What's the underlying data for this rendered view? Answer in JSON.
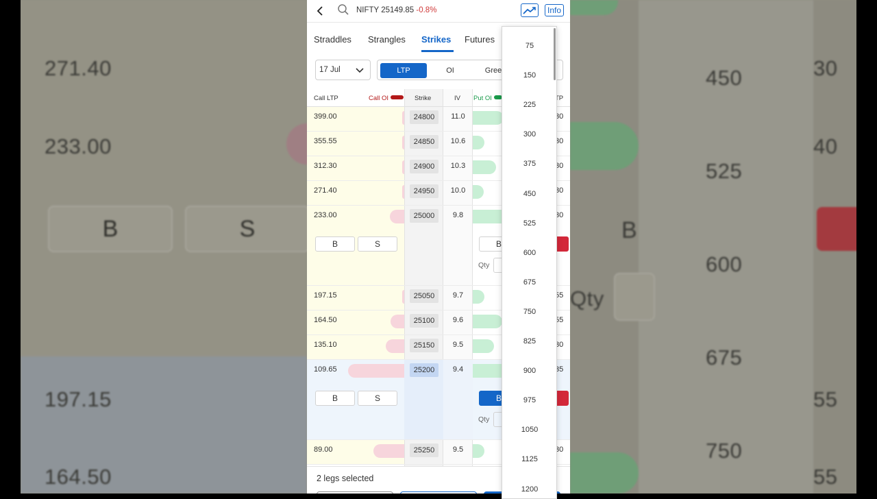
{
  "header": {
    "ticker_name": "NIFTY",
    "ticker_price": "25149.85",
    "ticker_change": "-0.8%",
    "info_label": "Info",
    "icons": [
      "chevron-left-icon",
      "search-icon",
      "trend-chart-icon"
    ]
  },
  "tabs": [
    {
      "label": "Straddles",
      "active": false
    },
    {
      "label": "Strangles",
      "active": false
    },
    {
      "label": "Strikes",
      "active": true
    },
    {
      "label": "Futures",
      "active": false
    }
  ],
  "controls": {
    "expiry_value": "17 Jul",
    "segments": [
      {
        "label": "LTP",
        "active": true
      },
      {
        "label": "OI",
        "active": false
      },
      {
        "label": "Gree",
        "active": false
      }
    ]
  },
  "table": {
    "headers": {
      "call_ltp": "Call LTP",
      "call_oi": "Call OI",
      "strike": "Strike",
      "iv": "IV",
      "put_oi": "Put OI",
      "put_ltp_fragment": "TP"
    },
    "rows": [
      {
        "call_ltp": "399.00",
        "strike": "24800",
        "iv": "11.0",
        "put_ltp_fragment": "30",
        "call_oi_pct": 2,
        "put_oi_pct": 32
      },
      {
        "call_ltp": "355.55",
        "strike": "24850",
        "iv": "10.6",
        "put_ltp_fragment": "30",
        "call_oi_pct": 1,
        "put_oi_pct": 12
      },
      {
        "call_ltp": "312.30",
        "strike": "24900",
        "iv": "10.3",
        "put_ltp_fragment": "30",
        "call_oi_pct": 2,
        "put_oi_pct": 24
      },
      {
        "call_ltp": "271.40",
        "strike": "24950",
        "iv": "10.0",
        "put_ltp_fragment": "30",
        "call_oi_pct": 1,
        "put_oi_pct": 11
      },
      {
        "call_ltp": "233.00",
        "strike": "25000",
        "iv": "9.8",
        "put_ltp_fragment": "30",
        "call_oi_pct": 15,
        "put_oi_pct": 40,
        "expanded": true,
        "buy_label": "B",
        "sell_label": "S",
        "put_buy_label": "B",
        "qty_label": "Qty"
      },
      {
        "call_ltp": "197.15",
        "strike": "25050",
        "iv": "9.7",
        "put_ltp_fragment": "55",
        "call_oi_pct": 2,
        "put_oi_pct": 12
      },
      {
        "call_ltp": "164.50",
        "strike": "25100",
        "iv": "9.6",
        "put_ltp_fragment": "55",
        "call_oi_pct": 14,
        "put_oi_pct": 30
      },
      {
        "call_ltp": "135.10",
        "strike": "25150",
        "iv": "9.5",
        "put_ltp_fragment": "30",
        "call_oi_pct": 19,
        "put_oi_pct": 22
      },
      {
        "call_ltp": "109.65",
        "strike": "25200",
        "iv": "9.4",
        "put_ltp_fragment": "35",
        "call_oi_pct": 58,
        "put_oi_pct": 40,
        "expanded": true,
        "selected": true,
        "buy_label": "B",
        "sell_label": "S",
        "put_buy_label": "B",
        "qty_label": "Qty"
      },
      {
        "call_ltp": "89.00",
        "strike": "25250",
        "iv": "9.5",
        "put_ltp_fragment": "30",
        "call_oi_pct": 32,
        "put_oi_pct": 12
      }
    ]
  },
  "footer": {
    "legs_text": "2 legs selected"
  },
  "qty_dropdown": {
    "options": [
      "75",
      "150",
      "225",
      "300",
      "375",
      "450",
      "525",
      "600",
      "675",
      "750",
      "825",
      "900",
      "975",
      "1050",
      "1125",
      "1200"
    ]
  },
  "backdrop_left": {
    "numbers": [
      "271.40",
      "233.00",
      "197.15",
      "164.50"
    ],
    "buy_label": "B",
    "sell_label": "S"
  },
  "backdrop_right": {
    "numbers": [
      "450",
      "525",
      "600",
      "675",
      "750"
    ],
    "fragments": [
      "30",
      "40",
      "55",
      "55"
    ],
    "buy_label": "B",
    "qty_label": "Qty"
  }
}
